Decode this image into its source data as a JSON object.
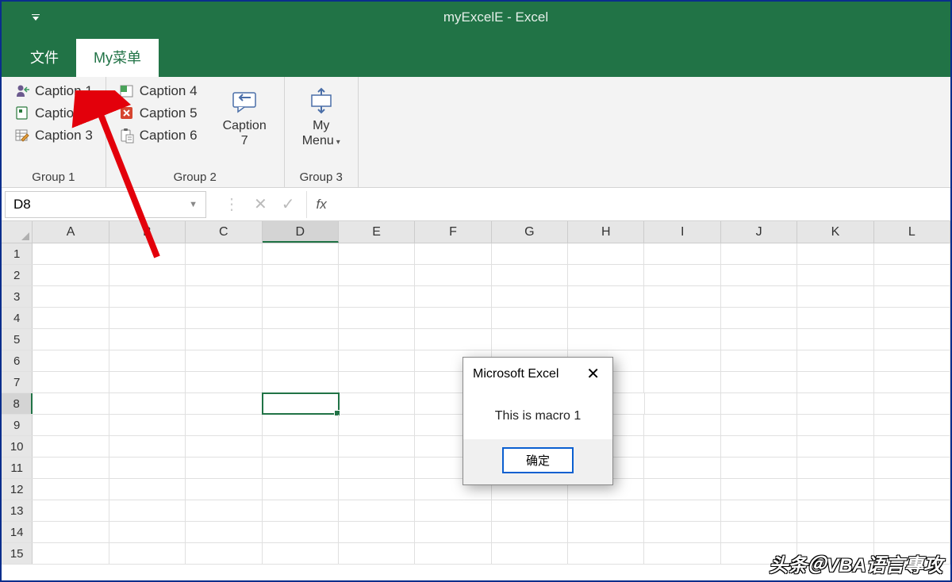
{
  "title": "myExcelE  -  Excel",
  "tabs": {
    "file": "文件",
    "mymenu": "My菜单"
  },
  "ribbon": {
    "group1": {
      "label": "Group 1",
      "c1": "Caption 1",
      "c2": "Caption 2",
      "c3": "Caption 3"
    },
    "group2": {
      "label": "Group 2",
      "c4": "Caption 4",
      "c5": "Caption 5",
      "c6": "Caption 6",
      "c7_line1": "Caption",
      "c7_line2": "7"
    },
    "group3": {
      "label": "Group 3",
      "menu_line1": "My",
      "menu_line2": "Menu"
    }
  },
  "namebox": "D8",
  "fx_label": "fx",
  "columns": [
    "A",
    "B",
    "C",
    "D",
    "E",
    "F",
    "G",
    "H",
    "I",
    "J",
    "K",
    "L"
  ],
  "rows": [
    1,
    2,
    3,
    4,
    5,
    6,
    7,
    8,
    9,
    10,
    11,
    12,
    13,
    14,
    15
  ],
  "active_col": "D",
  "active_row": 8,
  "msgbox": {
    "title": "Microsoft Excel",
    "body": "This is macro 1",
    "ok": "确定"
  },
  "watermark": "头条＠VBA语言專攻"
}
